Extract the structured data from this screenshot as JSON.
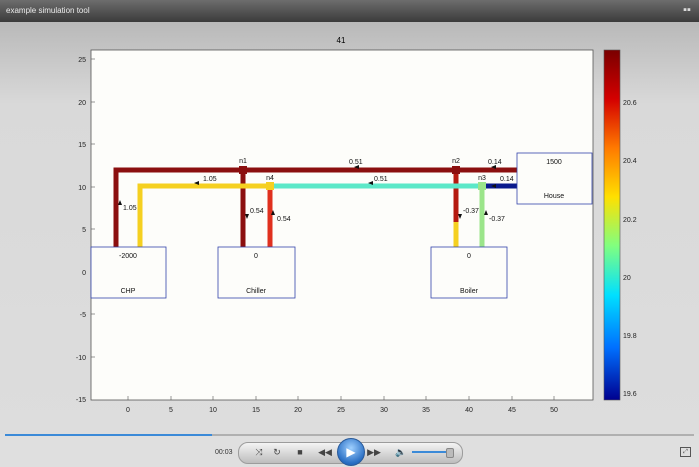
{
  "window": {
    "title": "example simulation tool"
  },
  "plot": {
    "title": "41",
    "x_ticks": [
      "0",
      "5",
      "10",
      "15",
      "20",
      "25",
      "30",
      "35",
      "40",
      "45",
      "50"
    ],
    "y_ticks": [
      "25",
      "20",
      "15",
      "10",
      "5",
      "0",
      "-5",
      "-10",
      "-15"
    ],
    "nodes": [
      "n1",
      "n2",
      "n3",
      "n4"
    ],
    "boxes": [
      {
        "value": "-2000",
        "label": "CHP"
      },
      {
        "value": "0",
        "label": "Chiller"
      },
      {
        "value": "0",
        "label": "Boiler"
      },
      {
        "value": "1500",
        "label": "House"
      }
    ],
    "flows": {
      "chp_supply": "1.05",
      "top_return": "1.05",
      "chiller_left": "0.54",
      "chiller_right": "0.54",
      "n1_n2_top": "0.51",
      "n4_n3_mid": "0.51",
      "boiler_left": "-0.37",
      "boiler_right": "-0.37",
      "house_top": "0.14",
      "house_mid": "0.14"
    },
    "colorbar": {
      "ticks": [
        "20.6",
        "20.4",
        "20.2",
        "20",
        "19.8",
        "19.6"
      ],
      "colors": [
        "#7a0000",
        "#d40000",
        "#ff7a00",
        "#ffe000",
        "#80ff80",
        "#00e0ff",
        "#0070ff",
        "#00008f"
      ]
    },
    "pipe_colors": {
      "dark_red": "#8b0f0f",
      "red": "#e0301e",
      "yellow": "#f5d020",
      "cyan": "#5ce8c8",
      "navy": "#0a1a8c",
      "green": "#9be58a"
    }
  },
  "player": {
    "time": "00:03",
    "progress_fraction": 0.3,
    "volume_fraction": 0.85
  }
}
